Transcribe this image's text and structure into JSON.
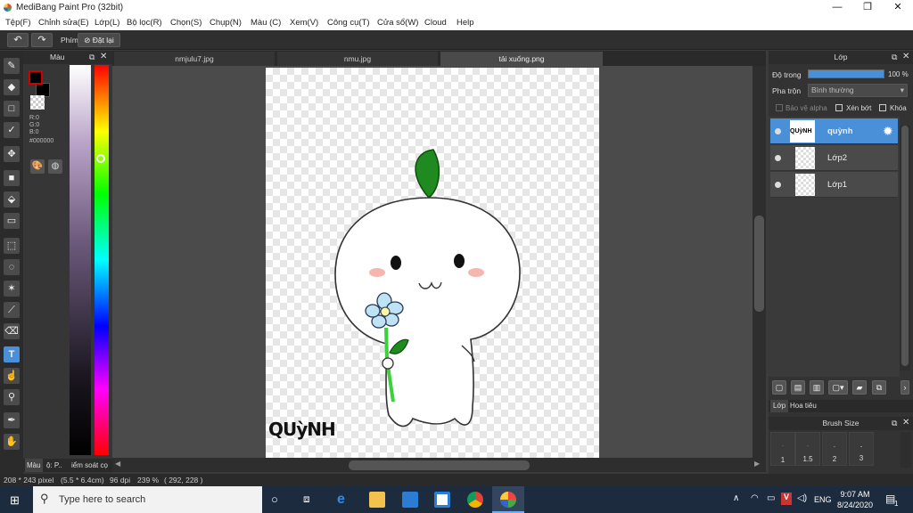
{
  "window": {
    "title": "MediBang Paint Pro (32bit)"
  },
  "menu": [
    "Tệp(F)",
    "Chỉnh sửa(E)",
    "Lớp(L)",
    "Bộ lọc(R)",
    "Chọn(S)",
    "Chụp(N)",
    "Màu (C)",
    "Xem(V)",
    "Công cụ(T)",
    "Cửa sổ(W)",
    "Cloud",
    "Help"
  ],
  "toolbar": {
    "shortcut_label": "Phím",
    "reset_label": "Đặt lại"
  },
  "color_panel": {
    "title": "Màu",
    "r": "R:0",
    "g": "G:0",
    "b": "B:0",
    "hex": "#000000",
    "bottom_tabs": [
      "Màu",
      "ộ: P..",
      "iểm soát cọ"
    ],
    "fg": "#000000",
    "hue_accent": "#a020f0"
  },
  "tabs": [
    "nmjulu7.jpg",
    "nmu.jpg",
    "tải xuống.png"
  ],
  "canvas": {
    "signature": "QUỳNH"
  },
  "layers_panel": {
    "title": "Lớp",
    "opacity_label": "Độ trong",
    "opacity_value": "100 %",
    "blend_label": "Pha trộn",
    "blend_value": "Bình thường",
    "protect_alpha": "Bảo vệ alpha",
    "clip_label": "Xén bớt",
    "lock_label": "Khóa",
    "layers": [
      {
        "name": "quỳnh",
        "thumb_text": "QUỳNH",
        "selected": true
      },
      {
        "name": "Lớp2",
        "selected": false
      },
      {
        "name": "Lớp1",
        "selected": false
      }
    ],
    "tabs": [
      "Lớp",
      "Hoa tiêu"
    ],
    "selected_color": "#4a90d9"
  },
  "brush_size": {
    "title": "Brush Size",
    "sizes": [
      "1",
      "1.5",
      "2",
      "3"
    ]
  },
  "status": {
    "size": "208 * 243 pixel",
    "physical": "(5.5 * 6.4cm)",
    "dpi": "96 dpi",
    "zoom": "239 %",
    "coords": "( 292, 228 )"
  },
  "taskbar": {
    "search_placeholder": "Type here to search",
    "lang": "ENG",
    "time": "9:07 AM",
    "date": "8/24/2020",
    "notifications": "1"
  }
}
